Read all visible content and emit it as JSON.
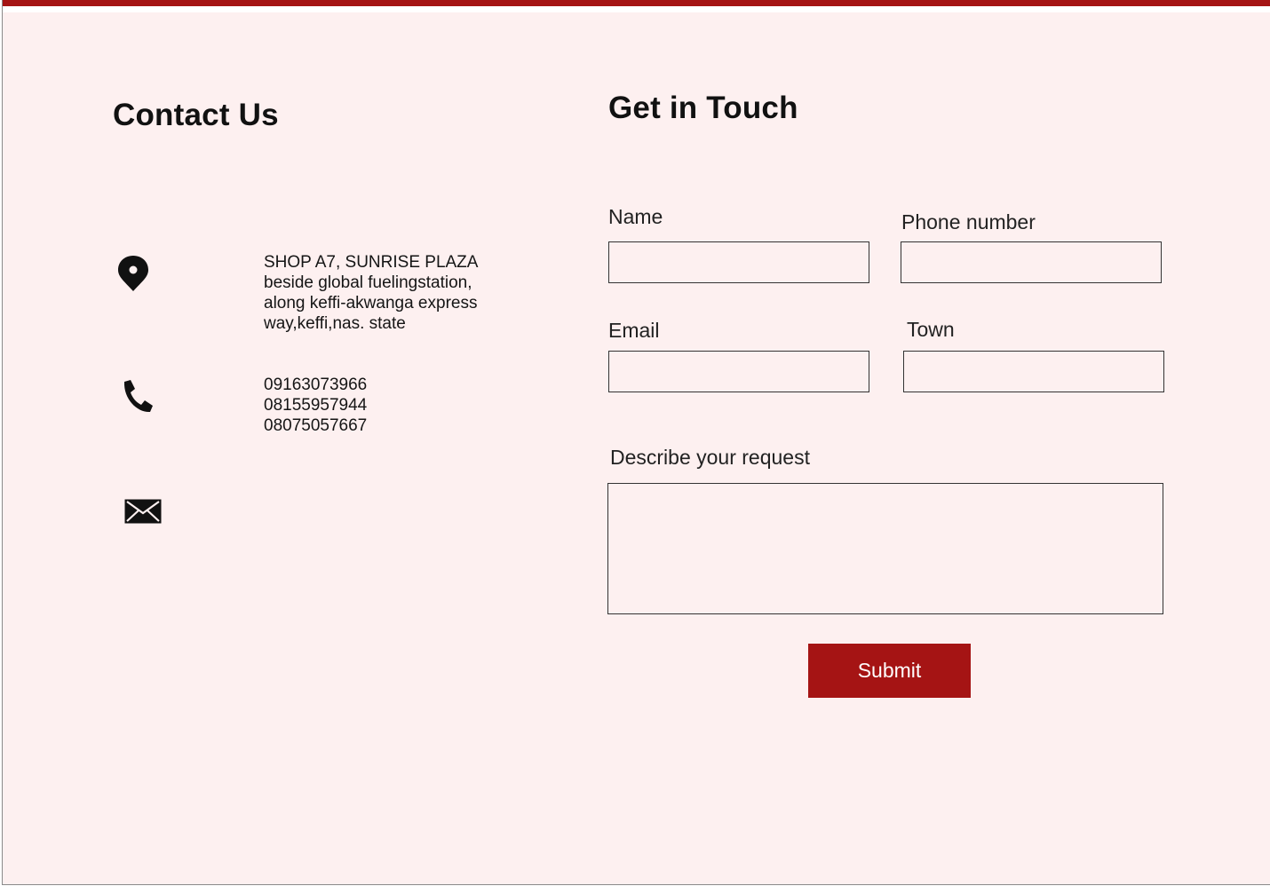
{
  "colors": {
    "accent": "#a51414",
    "background": "#fdf0f0",
    "text": "#111111"
  },
  "contact": {
    "title": "Contact Us",
    "address": {
      "icon": "location-pin-icon",
      "lines": [
        "SHOP A7, SUNRISE PLAZA",
        "beside global fuelingstation,",
        "along keffi-akwanga express",
        "way,keffi,nas. state"
      ]
    },
    "phone": {
      "icon": "phone-icon",
      "numbers": [
        "09163073966",
        "08155957944",
        "08075057667"
      ]
    },
    "email": {
      "icon": "mail-icon"
    }
  },
  "form": {
    "title": "Get in Touch",
    "name_label": "Name",
    "phone_label": "Phone number",
    "email_label": "Email",
    "town_label": "Town",
    "request_label": "Describe your request",
    "name_value": "",
    "phone_value": "",
    "email_value": "",
    "town_value": "",
    "request_value": "",
    "submit_label": "Submit"
  }
}
